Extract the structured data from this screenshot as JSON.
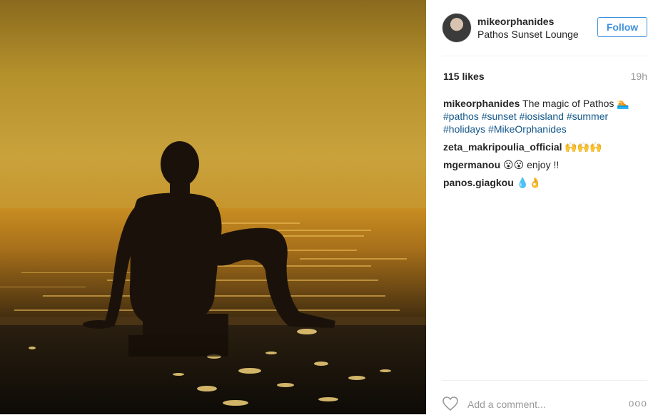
{
  "post": {
    "username": "mikeorphanides",
    "location": "Pathos Sunset Lounge",
    "follow_label": "Follow",
    "likes": "115 likes",
    "time": "19h"
  },
  "caption": {
    "user": "mikeorphanides",
    "text": "The magic of Pathos",
    "emoji": "🏊",
    "tags": [
      "#pathos",
      "#sunset",
      "#iosisland",
      "#summer",
      "#holidays",
      "#MikeOrphanides"
    ]
  },
  "comments": [
    {
      "user": "zeta_makripoulia_official",
      "text": "🙌🙌🙌"
    },
    {
      "user": "mgermanou",
      "text": "😮😮 enjoy !!"
    },
    {
      "user": "panos.giagkou",
      "text": "💧👌"
    }
  ],
  "compose": {
    "placeholder": "Add a comment...",
    "more_label": "ooo"
  },
  "icons": {
    "like": "heart-icon",
    "more": "more-options-icon"
  },
  "colors": {
    "accent": "#4090db",
    "tag": "#125688"
  }
}
